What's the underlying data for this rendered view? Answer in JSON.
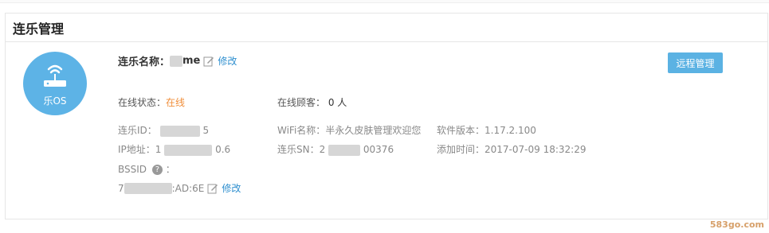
{
  "panel": {
    "title": "连乐管理"
  },
  "device": {
    "logo_text": "乐OS",
    "name_label": "连乐名称：",
    "name_value_suffix": "me",
    "edit_label": "修改",
    "remote_button": "远程管理",
    "status_label": "在线状态：",
    "status_value": "在线",
    "customers_label": "在线顾客：",
    "customers_value": "0 人",
    "id_label": "连乐ID：",
    "id_suffix": "5",
    "wifi_label": "WiFi名称：",
    "wifi_value": "半永久皮肤管理欢迎您",
    "software_label": "软件版本：",
    "software_value": "1.17.2.100",
    "ip_label": "IP地址：",
    "ip_prefix": "1",
    "ip_suffix": "0.6",
    "sn_label": "连乐SN：",
    "sn_prefix": "2",
    "sn_suffix": "00376",
    "added_label": "添加时间：",
    "added_value": "2017-07-09 18:32:29",
    "bssid_label": "BSSID",
    "bssid_colon": "：",
    "bssid_prefix": "7",
    "bssid_suffix": ":AD:6E",
    "bssid_edit_label": "修改"
  },
  "watermark": "583go.com",
  "colors": {
    "accent": "#5bb2e3",
    "status_online": "#f08e3a",
    "link": "#2f8fcf"
  }
}
